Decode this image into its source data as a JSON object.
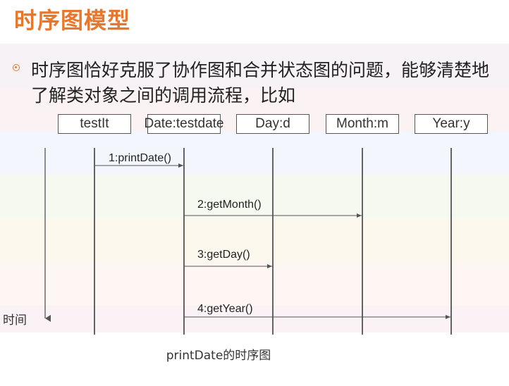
{
  "slide": {
    "title": "时序图模型",
    "bullet_text": "时序图恰好克服了协作图和合并状态图的问题，能够清楚地了解类对象之间的调用流程，比如",
    "time_label": "时间",
    "caption": "printDate的时序图"
  },
  "colors": {
    "title": "#e8772e",
    "bullet": "#e8772e",
    "lines": "#333333"
  },
  "objects": [
    "testIt",
    "Date:testdate",
    "Day:d",
    "Month:m",
    "Year:y"
  ],
  "messages": [
    {
      "label": "1:printDate()",
      "from": "testIt",
      "to": "Date:testdate"
    },
    {
      "label": "2:getMonth()",
      "from": "Date:testdate",
      "to": "Month:m"
    },
    {
      "label": "3:getDay()",
      "from": "Date:testdate",
      "to": "Day:d"
    },
    {
      "label": "4:getYear()",
      "from": "Date:testdate",
      "to": "Year:y"
    }
  ]
}
